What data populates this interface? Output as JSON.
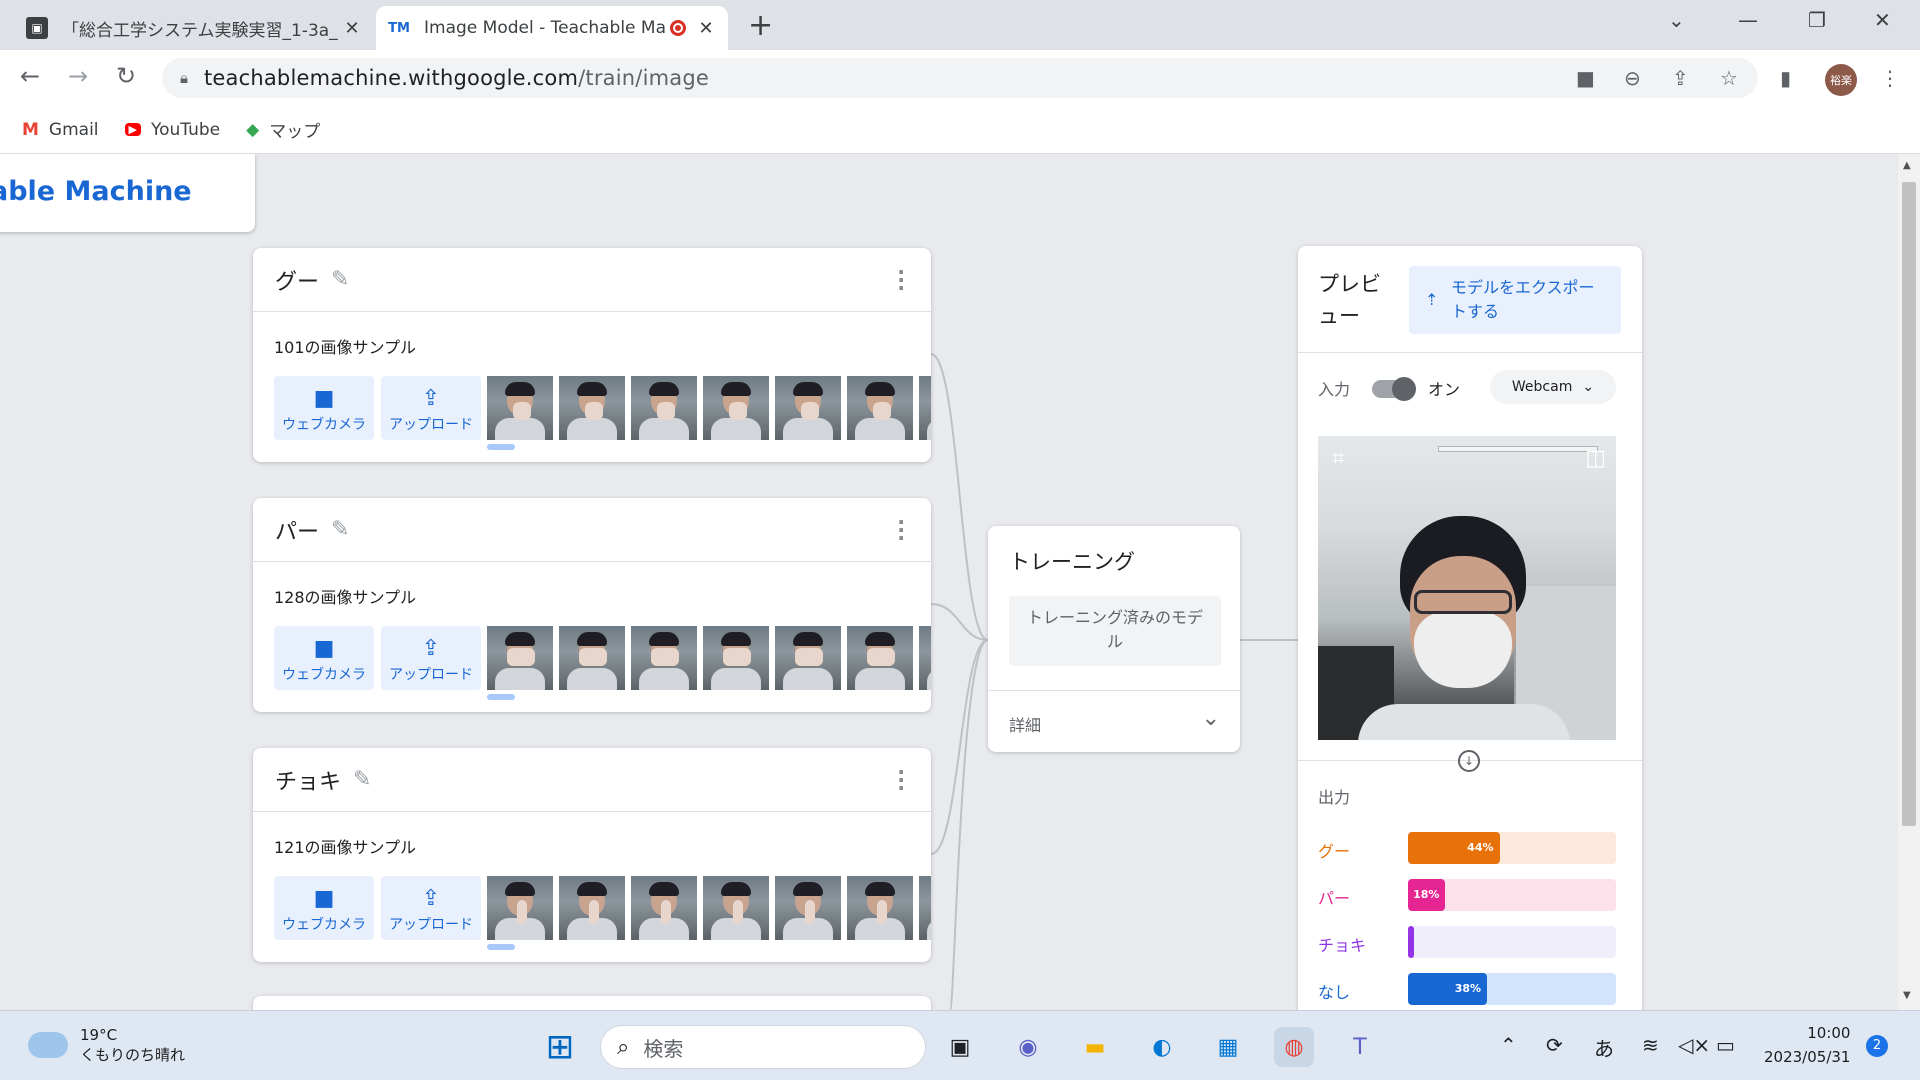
{
  "browser": {
    "tabs": [
      {
        "title": "「総合工学システム実験実習_1-3a_",
        "favicon": "person-card-icon"
      },
      {
        "title": "Image Model - Teachable Ma",
        "favicon": "TM",
        "recording": true
      }
    ],
    "url": {
      "host": "teachablemachine.withgoogle.com",
      "path": "/train/image"
    },
    "profile_initials": "裕楽",
    "bookmarks": [
      {
        "label": "Gmail",
        "icon": "gmail-icon"
      },
      {
        "label": "YouTube",
        "icon": "youtube-icon"
      },
      {
        "label": "マップ",
        "icon": "maps-icon"
      }
    ]
  },
  "app": {
    "logo_text": "able Machine"
  },
  "classes": [
    {
      "name": "グー",
      "count_label": "101の画像サンプル",
      "webcam_label": "ウェブカメラ",
      "upload_label": "アップロード"
    },
    {
      "name": "パー",
      "count_label": "128の画像サンプル",
      "webcam_label": "ウェブカメラ",
      "upload_label": "アップロード"
    },
    {
      "name": "チョキ",
      "count_label": "121の画像サンプル",
      "webcam_label": "ウェブカメラ",
      "upload_label": "アップロード"
    }
  ],
  "training": {
    "title": "トレーニング",
    "button": "トレーニング済みのモデル",
    "details": "詳細"
  },
  "preview": {
    "title": "プレビュー",
    "export_button": "モデルをエクスポートする",
    "input_label": "入力",
    "input_state": "オン",
    "source": "Webcam",
    "output_label": "出力",
    "outputs": [
      {
        "label": "グー",
        "percent_text": "44%",
        "value": 0.44,
        "color": "#e8710a",
        "track": "#fde9dd"
      },
      {
        "label": "パー",
        "percent_text": "18%",
        "value": 0.18,
        "color": "#e52592",
        "track": "#fce0ea"
      },
      {
        "label": "チョキ",
        "percent_text": "",
        "value": 0.0,
        "color": "#9334e6",
        "track": "#f1eefc"
      },
      {
        "label": "なし",
        "percent_text": "38%",
        "value": 0.38,
        "color": "#1967d2",
        "track": "#d2e3fc"
      }
    ]
  },
  "taskbar": {
    "weather_temp": "19°C",
    "weather_desc": "くもりのち晴れ",
    "search_placeholder": "検索",
    "ime": "あ",
    "time": "10:00",
    "date": "2023/05/31",
    "notifications": "2"
  }
}
